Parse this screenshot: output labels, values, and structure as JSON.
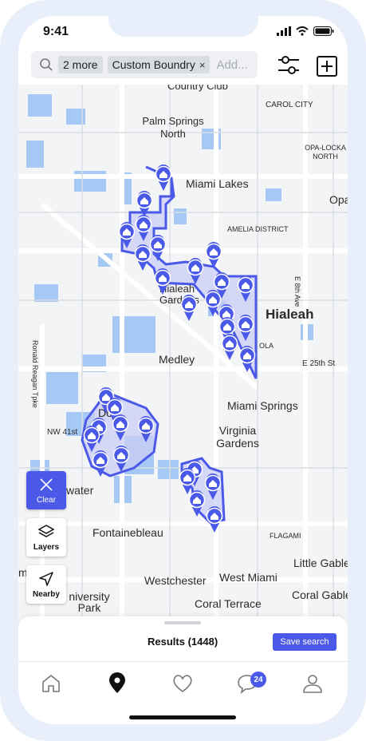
{
  "status": {
    "time": "9:41"
  },
  "search": {
    "chip_more": "2 more",
    "chip_custom": "Custom Boundry",
    "chip_close": "×",
    "placeholder": "Add..."
  },
  "map": {
    "labels": {
      "country_club": "Country Club",
      "carol_city": "CAROL CITY",
      "palm_springs_north": "Palm Springs North",
      "opa_locka_north": "OPA-LOCKA NORTH",
      "miami_lakes": "Miami Lakes",
      "opa": "Opa",
      "amelia_district": "AMELIA DISTRICT",
      "e8th_ave": "E 8th Ave",
      "hialeah_gardens": "Hialeah Gardens",
      "hialeah": "Hialeah",
      "e25th": "E 25th St",
      "ola": "OLA",
      "medley": "Medley",
      "ronald_reagan": "Ronald Reagan Tpke",
      "doral": "Do",
      "nw41st": "NW 41st",
      "miami_springs": "Miami Springs",
      "virginia_gardens": "Virginia Gardens",
      "water": "water",
      "fontainebleau": "Fontainebleau",
      "flagami": "FLAGAMI",
      "little_gable": "Little Gable",
      "westchester": "Westchester",
      "west_miami": "West Miami",
      "coral_gable": "Coral Gable",
      "university_park": "niversity Park",
      "coral_terrace": "Coral Terrace",
      "m": "m"
    },
    "controls": {
      "clear": "Clear",
      "layers": "Layers",
      "nearby": "Nearby"
    }
  },
  "results": {
    "label": "Results (1448)",
    "save": "Save search"
  },
  "tabs": {
    "badge_count": "24"
  },
  "colors": {
    "accent": "#4a59e8",
    "region_fill": "#c9cdf4",
    "water": "#a6c8f5"
  }
}
